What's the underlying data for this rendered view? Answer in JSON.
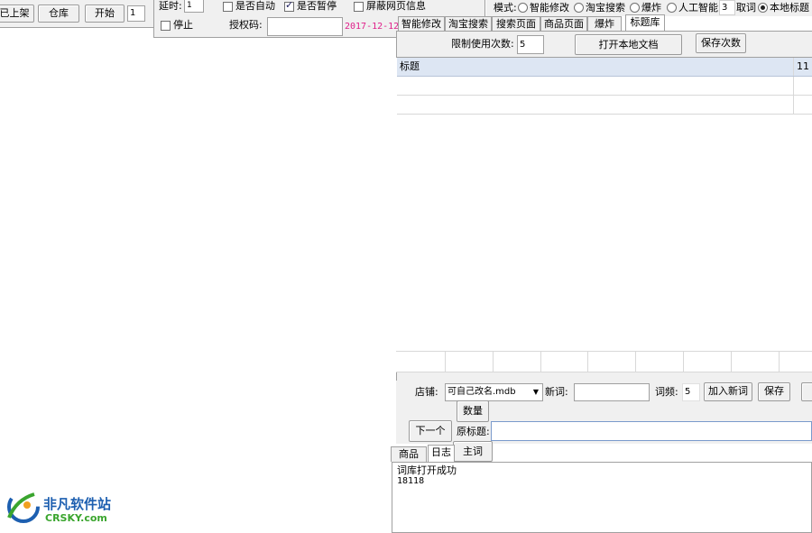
{
  "toolbar_left": {
    "listed_label": "已上架",
    "warehouse_label": "仓库",
    "start_label": "开始",
    "count_value": "1"
  },
  "options": {
    "delay_label": "延时:",
    "delay_value": "1",
    "auto_label": "是否自动",
    "pause_label": "是否暂停",
    "block_label": "屏蔽网页信息",
    "stop_label": "停止",
    "auth_label": "授权码:",
    "auth_value": "",
    "date_text": "2017-12-12"
  },
  "mode": {
    "label": "模式:",
    "options": [
      "智能修改",
      "淘宝搜索",
      "爆炸",
      "人工智能"
    ],
    "word_count": "3",
    "take_word_label": "取词",
    "local_title_label": "本地标题",
    "local_title_checked": true
  },
  "tabs": [
    "智能修改",
    "淘宝搜索",
    "搜索页面",
    "商品页面",
    "爆炸",
    "标题库"
  ],
  "active_tab": "标题库",
  "title_lib": {
    "limit_label": "限制使用次数:",
    "limit_value": "5",
    "open_doc_label": "打开本地文档",
    "save_count_label": "保存次数",
    "grid_headers": [
      "标题",
      "11"
    ]
  },
  "shop_row": {
    "shop_label": "店铺:",
    "shop_value": "可自己改名.mdb",
    "new_word_label": "新词:",
    "new_word_value": "",
    "freq_label": "词频:",
    "freq_value": "5",
    "add_new_word_label": "加入新词",
    "save_label": "保存"
  },
  "action_row": {
    "quantity_label": "数量",
    "next_label": "下一个",
    "original_title_label": "原标题:",
    "original_title_value": "",
    "main_word_label": "主词"
  },
  "log": {
    "tabs": [
      "商品",
      "日志"
    ],
    "active": "日志",
    "lines": [
      "词库打开成功",
      "18118"
    ]
  },
  "watermark": {
    "cn": "非凡软件站",
    "en": "CRSKY.com"
  },
  "colors": {
    "date_text": "#e0208a",
    "grid_header_bg": "#dde6f3",
    "logo_blue": "#1d5fb0",
    "logo_green": "#3aa52e"
  }
}
